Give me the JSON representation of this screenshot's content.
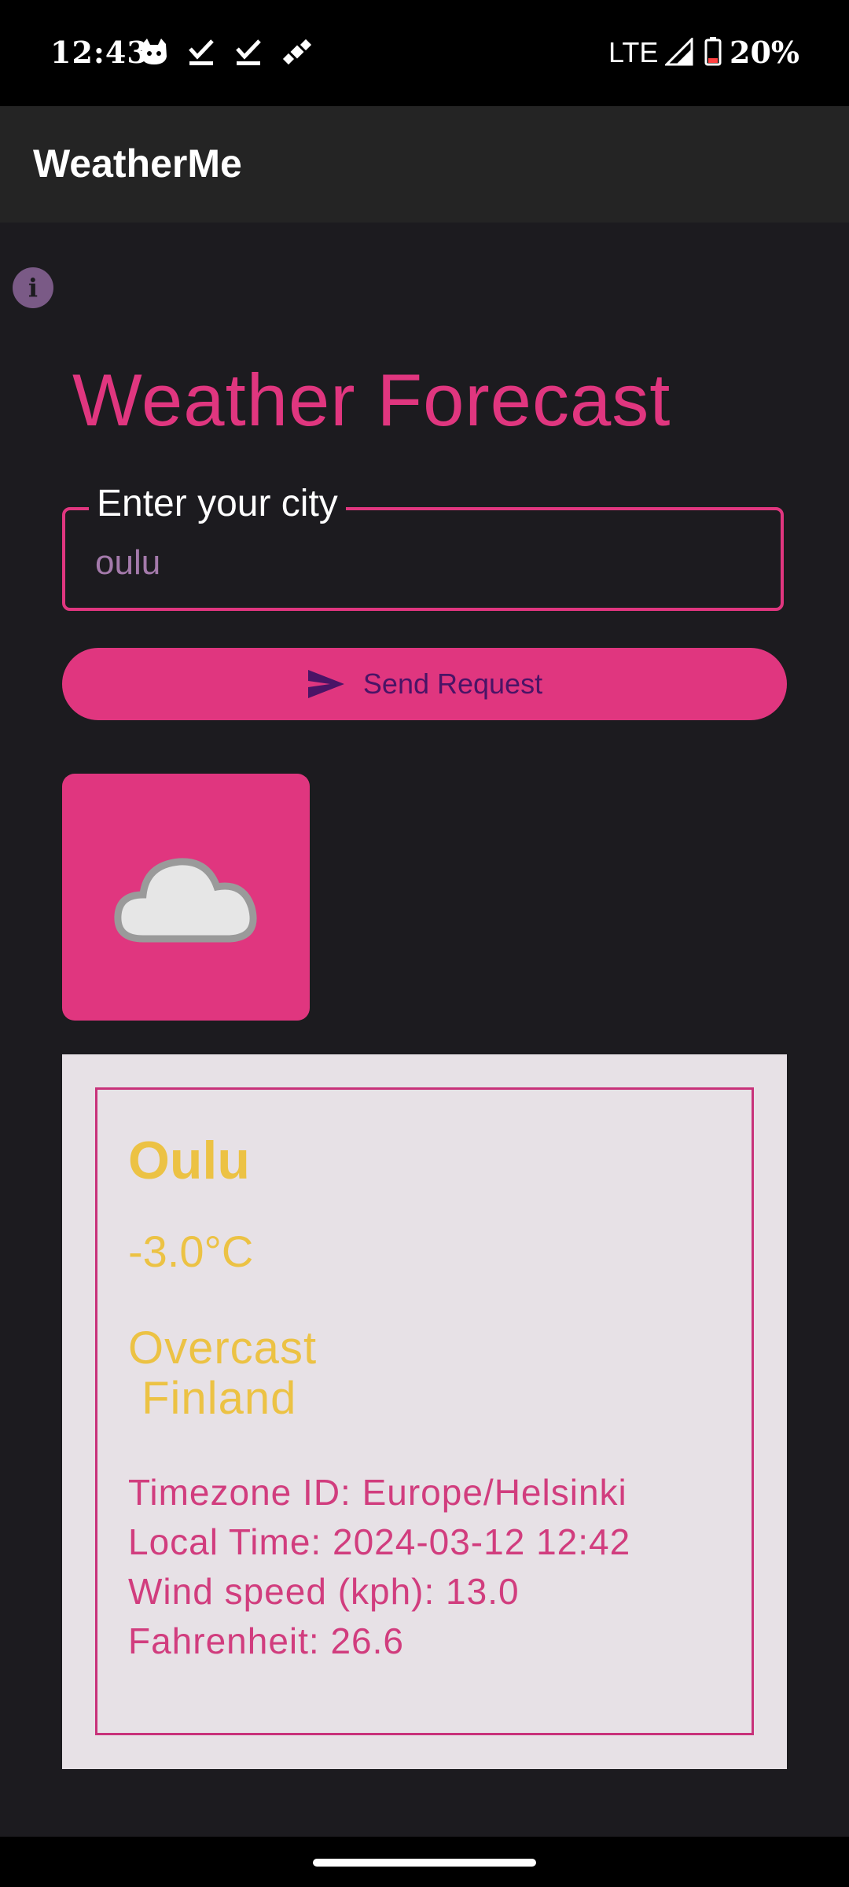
{
  "status_bar": {
    "time": "12:43",
    "network": "LTE",
    "battery": "20%",
    "icons": [
      "cat-notification-icon",
      "check-icon",
      "check-icon",
      "satellite-icon",
      "signal-icon",
      "battery-icon"
    ]
  },
  "app_bar": {
    "title": "WeatherMe"
  },
  "info_button": {
    "label": "i"
  },
  "heading": "Weather Forecast",
  "search": {
    "label": "Enter your city",
    "value": "oulu"
  },
  "send_button": {
    "label": "Send Request",
    "icon": "send-icon"
  },
  "weather_icon": {
    "name": "cloud-icon"
  },
  "weather": {
    "city": "Oulu",
    "temperature": "-3.0°C",
    "condition": "Overcast",
    "country": " Finland",
    "timezone": "Timezone ID: Europe/Helsinki",
    "local_time": "Local Time: 2024-03-12 12:42",
    "wind": "Wind speed (kph): 13.0",
    "fahrenheit": "Fahrenheit: 26.6"
  },
  "colors": {
    "accent": "#e0367f",
    "background": "#1c1b1f",
    "app_bar": "#242424",
    "panel": "#e7e1e6",
    "highlight_text": "#ecc244"
  }
}
